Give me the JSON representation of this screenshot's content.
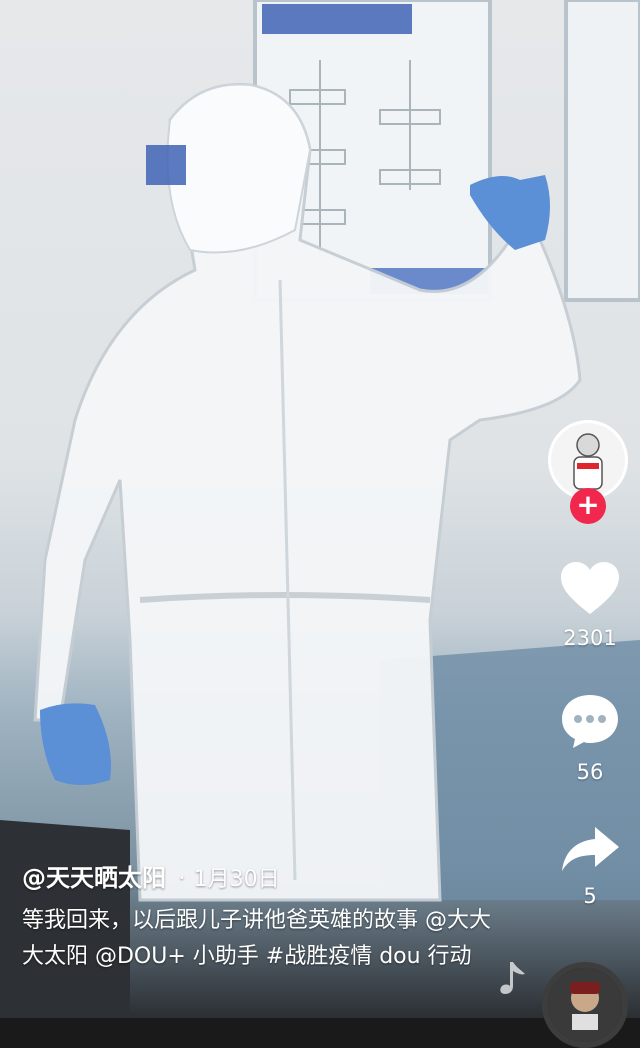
{
  "video": {
    "author": "@天天晒太阳",
    "date": "1月30日",
    "date_separator": "·",
    "description": "等我回来，以后跟儿子讲他爸英雄的故事 @大大大太阳 @DOU+ 小助手 #战胜疫情 dou 行动"
  },
  "actions": {
    "likes": "2301",
    "comments": "56",
    "shares": "5"
  },
  "icons": {
    "like": "heart-icon",
    "comment": "comment-bubble-icon",
    "share": "share-arrow-icon",
    "follow": "plus-icon",
    "music": "music-note-icon"
  },
  "colors": {
    "follow_button": "#f2274e",
    "text": "#ffffff"
  }
}
